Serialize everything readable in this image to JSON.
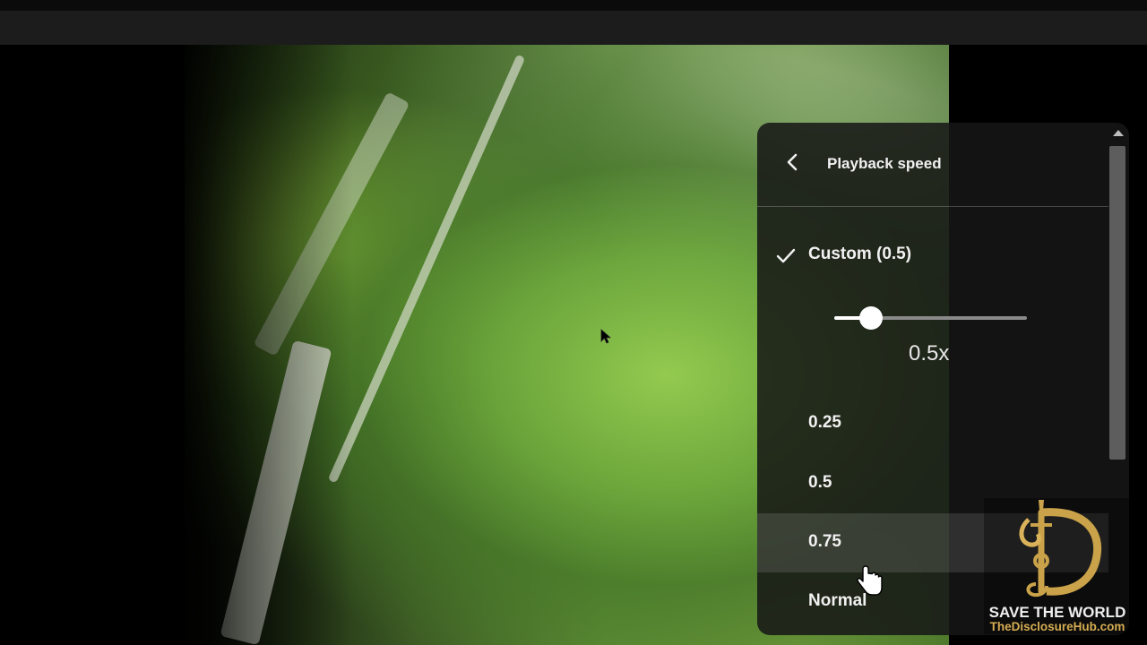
{
  "player": {
    "settings_menu": {
      "title": "Playback speed",
      "back_icon": "chevron-left-icon",
      "custom_option": {
        "label": "Custom (0.5)",
        "selected": true,
        "check_icon": "check-icon"
      },
      "custom_slider": {
        "value": 0.5,
        "min": 0.25,
        "max": 2,
        "readout": "0.5x"
      },
      "options": [
        {
          "label": "0.25"
        },
        {
          "label": "0.5"
        },
        {
          "label": "0.75",
          "hovered": true
        },
        {
          "label": "Normal"
        }
      ]
    },
    "cursors": [
      "mouse-pointer-icon",
      "hand-pointer-icon"
    ]
  },
  "watermark": {
    "logo_icon": "sword-letter-d-logo-icon",
    "line1": "SAVE THE WORLD",
    "line2": "TheDisclosureHub.com",
    "accent_color": "#c9a24a"
  },
  "colors": {
    "menu_background": "#161616",
    "menu_text": "#f1f1f1",
    "slider_track": "#8a8a8a",
    "slider_fill": "#ffffff"
  }
}
